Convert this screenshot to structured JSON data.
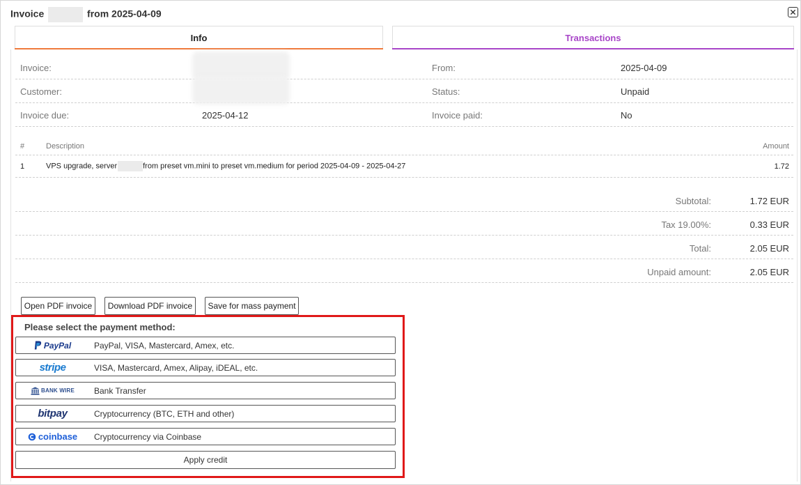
{
  "header": {
    "title_prefix": "Invoice",
    "title_suffix": "from 2025-04-09",
    "close_icon": "close-icon"
  },
  "tabs": [
    {
      "label": "Info",
      "active": true,
      "color": "#ef7a3c"
    },
    {
      "label": "Transactions",
      "active": false,
      "color": "#a845c8"
    }
  ],
  "info": {
    "invoice_label": "Invoice:",
    "customer_label": "Customer:",
    "due_label": "Invoice due:",
    "due_value": "2025-04-12",
    "from_label": "From:",
    "from_value": "2025-04-09",
    "status_label": "Status:",
    "status_value": "Unpaid",
    "paid_label": "Invoice paid:",
    "paid_value": "No"
  },
  "items": {
    "headers": {
      "num": "#",
      "description": "Description",
      "amount": "Amount"
    },
    "rows": [
      {
        "num": "1",
        "description_prefix": "VPS upgrade, server",
        "description_suffix": "from preset vm.mini to preset vm.medium for period 2025-04-09 - 2025-04-27",
        "amount": "1.72"
      }
    ]
  },
  "totals": [
    {
      "label": "Subtotal:",
      "value": "1.72 EUR"
    },
    {
      "label": "Tax 19.00%:",
      "value": "0.33 EUR"
    },
    {
      "label": "Total:",
      "value": "2.05 EUR"
    },
    {
      "label": "Unpaid amount:",
      "value": "2.05 EUR"
    }
  ],
  "actions": {
    "open_pdf": "Open PDF invoice",
    "download_pdf": "Download PDF invoice",
    "mass_payment": "Save for mass payment"
  },
  "payment": {
    "title": "Please select the payment method:",
    "methods": [
      {
        "logo": "PayPal",
        "desc": "PayPal, VISA, Mastercard, Amex, etc."
      },
      {
        "logo": "stripe",
        "desc": "VISA, Mastercard, Amex, Alipay, iDEAL, etc."
      },
      {
        "logo": "BANK WIRE",
        "desc": "Bank Transfer"
      },
      {
        "logo": "bitpay",
        "desc": "Cryptocurrency (BTC, ETH and other)"
      },
      {
        "logo": "coinbase",
        "desc": "Cryptocurrency via Coinbase"
      }
    ],
    "credit": "Apply credit",
    "highlight_color": "#e01919"
  }
}
